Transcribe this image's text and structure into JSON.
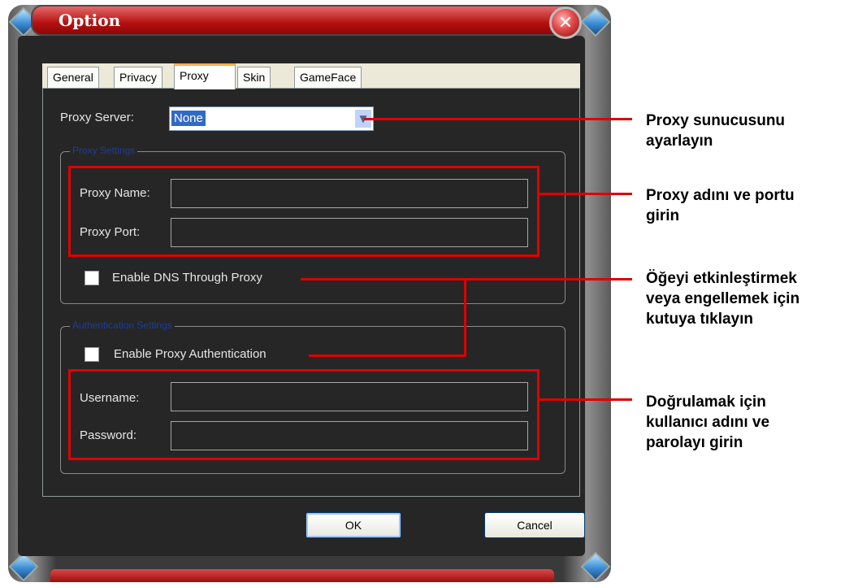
{
  "window": {
    "title": "Option",
    "close_icon": "close-icon"
  },
  "tabs": [
    {
      "label": "General",
      "active": false
    },
    {
      "label": "Privacy",
      "active": false
    },
    {
      "label": "Proxy",
      "active": true
    },
    {
      "label": "Skin",
      "active": false
    },
    {
      "label": "GameFace",
      "active": false
    }
  ],
  "proxy_server": {
    "label": "Proxy Server:",
    "value": "None"
  },
  "proxy_settings": {
    "group_title": "Proxy Settings",
    "name_label": "Proxy Name:",
    "name_value": "",
    "port_label": "Proxy Port:",
    "port_value": "",
    "dns_label": "Enable DNS Through Proxy",
    "dns_checked": false
  },
  "auth_settings": {
    "group_title": "Authentication Settings",
    "enable_label": "Enable Proxy Authentication",
    "enable_checked": false,
    "username_label": "Username:",
    "username_value": "",
    "password_label": "Password:",
    "password_value": ""
  },
  "buttons": {
    "ok": "OK",
    "cancel": "Cancel"
  },
  "callouts": {
    "server": "Proxy sunucusunu\nayarlayın",
    "name_port": "Proxy adını ve portu\ngirin",
    "checkbox": "Öğeyi etkinleştirmek\nveya engellemek için\nkutuya tıklayın",
    "credentials": "Doğrulamak için\nkullanıcı adını ve\nparolayı girin"
  },
  "colors": {
    "annotation_red": "#e00000",
    "title_red": "#b41010",
    "dialog_bg": "#262626"
  }
}
